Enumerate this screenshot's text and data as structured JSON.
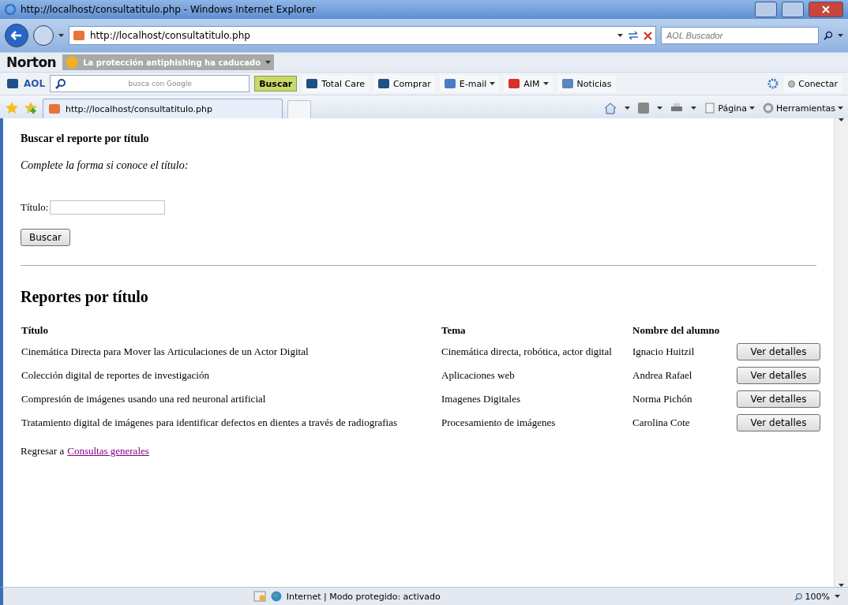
{
  "window": {
    "title": "http://localhost/consultatitulo.php - Windows Internet Explorer"
  },
  "address_bar": {
    "url": "http://localhost/consultatitulo.php",
    "search_placeholder": "AOL Buscador"
  },
  "norton_bar": {
    "brand": "Norton",
    "alert": "La protección antiphishing ha caducado"
  },
  "toolbar": {
    "brand": "AOL",
    "search_hint": "busca con Google",
    "search_button": "Buscar",
    "items": [
      {
        "label": "Total Care",
        "dropdown": false
      },
      {
        "label": "Comprar",
        "dropdown": false
      },
      {
        "label": "E-mail",
        "dropdown": true
      },
      {
        "label": "AIM",
        "dropdown": true
      },
      {
        "label": "Noticias",
        "dropdown": false
      }
    ],
    "connect": "Conectar"
  },
  "tabs": [
    {
      "title": "http://localhost/consultatitulo.php",
      "selected": true
    }
  ],
  "command_bar": [
    "Página",
    "Herramientas"
  ],
  "page": {
    "heading": "Buscar el reporte por título",
    "instructions": "Complete la forma si conoce el título:",
    "field_label": "Título:",
    "search_button": "Buscar",
    "section_heading": "Reportes por título",
    "table": {
      "columns": [
        "Título",
        "Tema",
        "Nombre del alumno"
      ],
      "rows": [
        {
          "title": "Cinemática Directa para Mover las Articulaciones de un Actor Digital",
          "topic": "Cinemática directa, robótica, actor digital",
          "student": "Ignacio Huitzil",
          "button": "Ver detalles"
        },
        {
          "title": "Colección digital de reportes de investigación",
          "topic": "Aplicaciones web",
          "student": "Andrea Rafael",
          "button": "Ver detalles"
        },
        {
          "title": "Compresión de imágenes usando una red neuronal artificial",
          "topic": "Imagenes Digitales",
          "student": "Norma Pichón",
          "button": "Ver detalles"
        },
        {
          "title": "Tratamiento digital de imágenes para identificar defectos en dientes a través de radiografias",
          "topic": "Procesamiento de imágenes",
          "student": "Carolina Cote",
          "button": "Ver detalles"
        }
      ]
    },
    "back_text": "Regresar a",
    "back_link": "Consultas generales"
  },
  "status_bar": {
    "zone": "Internet | Modo protegido: activado",
    "zoom": "100%"
  }
}
